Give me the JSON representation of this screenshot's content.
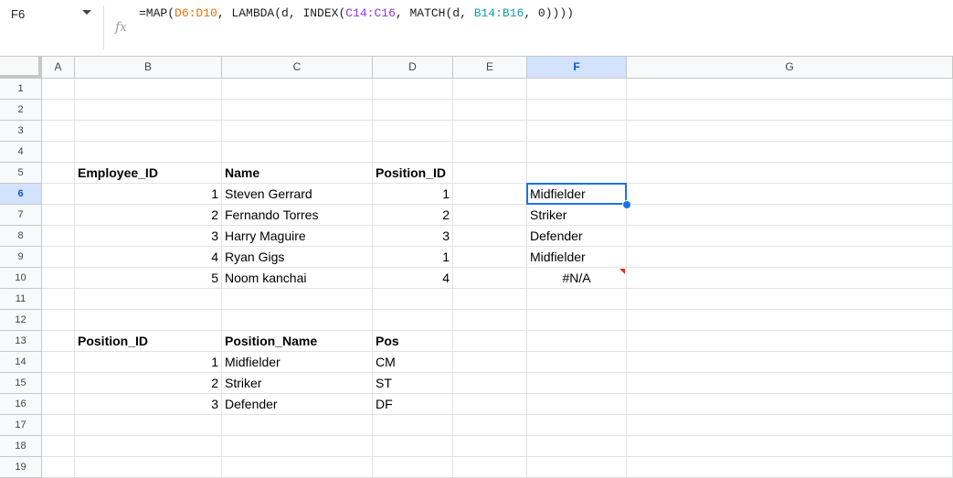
{
  "name_box": {
    "value": "F6"
  },
  "formula_bar": {
    "fx_label": "fx",
    "formula_parts": [
      {
        "text": "=MAP(",
        "color": "#1f1f1f"
      },
      {
        "text": "D6:D10",
        "color": "#e8710a"
      },
      {
        "text": ", LAMBDA(d, INDEX(",
        "color": "#1f1f1f"
      },
      {
        "text": "C14:C16",
        "color": "#9334e6"
      },
      {
        "text": ", MATCH(d, ",
        "color": "#1f1f1f"
      },
      {
        "text": "B14:B16",
        "color": "#129eaf"
      },
      {
        "text": ", 0))))",
        "color": "#1f1f1f"
      }
    ]
  },
  "grid": {
    "columns": [
      "A",
      "B",
      "C",
      "D",
      "E",
      "F",
      "G"
    ],
    "selected_column": "F",
    "rows": [
      "1",
      "2",
      "3",
      "4",
      "5",
      "6",
      "7",
      "8",
      "9",
      "10",
      "11",
      "12",
      "13",
      "14",
      "15",
      "16",
      "17",
      "18",
      "19"
    ],
    "selected_row": "6",
    "cells": [
      {
        "ref": "B5",
        "value": "Employee_ID",
        "bold": true
      },
      {
        "ref": "C5",
        "value": "Name",
        "bold": true
      },
      {
        "ref": "D5",
        "value": "Position_ID",
        "bold": true
      },
      {
        "ref": "B6",
        "value": "1",
        "align": "right"
      },
      {
        "ref": "C6",
        "value": "Steven Gerrard"
      },
      {
        "ref": "D6",
        "value": "1",
        "align": "right"
      },
      {
        "ref": "F6",
        "value": "Midfielder"
      },
      {
        "ref": "B7",
        "value": "2",
        "align": "right"
      },
      {
        "ref": "C7",
        "value": "Fernando Torres"
      },
      {
        "ref": "D7",
        "value": "2",
        "align": "right"
      },
      {
        "ref": "F7",
        "value": "Striker"
      },
      {
        "ref": "B8",
        "value": "3",
        "align": "right"
      },
      {
        "ref": "C8",
        "value": "Harry Maguire"
      },
      {
        "ref": "D8",
        "value": "3",
        "align": "right"
      },
      {
        "ref": "F8",
        "value": "Defender"
      },
      {
        "ref": "B9",
        "value": "4",
        "align": "right"
      },
      {
        "ref": "C9",
        "value": "Ryan Gigs"
      },
      {
        "ref": "D9",
        "value": "1",
        "align": "right"
      },
      {
        "ref": "F9",
        "value": "Midfielder"
      },
      {
        "ref": "B10",
        "value": "5",
        "align": "right"
      },
      {
        "ref": "C10",
        "value": "Noom kanchai"
      },
      {
        "ref": "D10",
        "value": "4",
        "align": "right"
      },
      {
        "ref": "F10",
        "value": "#N/A",
        "align": "center",
        "error": true
      },
      {
        "ref": "B13",
        "value": "Position_ID",
        "bold": true
      },
      {
        "ref": "C13",
        "value": "Position_Name",
        "bold": true
      },
      {
        "ref": "D13",
        "value": "Pos",
        "bold": true
      },
      {
        "ref": "B14",
        "value": "1",
        "align": "right"
      },
      {
        "ref": "C14",
        "value": "Midfielder"
      },
      {
        "ref": "D14",
        "value": "CM"
      },
      {
        "ref": "B15",
        "value": "2",
        "align": "right"
      },
      {
        "ref": "C15",
        "value": "Striker"
      },
      {
        "ref": "D15",
        "value": "ST"
      },
      {
        "ref": "B16",
        "value": "3",
        "align": "right"
      },
      {
        "ref": "C16",
        "value": "Defender"
      },
      {
        "ref": "D16",
        "value": "DF"
      }
    ],
    "active_cell": "F6",
    "colors": {
      "selection": "#1a73e8",
      "error_marker": "#d93025",
      "header_selected_bg": "#d3e3fd"
    }
  }
}
